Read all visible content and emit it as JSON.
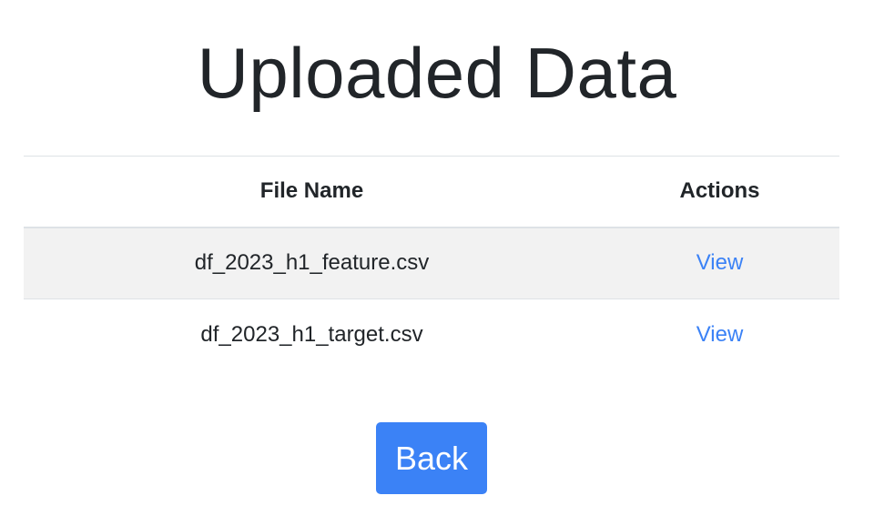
{
  "page": {
    "title": "Uploaded Data"
  },
  "table": {
    "headers": {
      "file_name": "File Name",
      "actions": "Actions"
    },
    "rows": [
      {
        "file_name": "df_2023_h1_feature.csv",
        "action_label": "View"
      },
      {
        "file_name": "df_2023_h1_target.csv",
        "action_label": "View"
      }
    ]
  },
  "back_button": {
    "label": "Back"
  },
  "colors": {
    "accent": "#3b82f6",
    "text": "#212529",
    "stripe": "#f2f2f2",
    "border": "#dee2e6"
  }
}
